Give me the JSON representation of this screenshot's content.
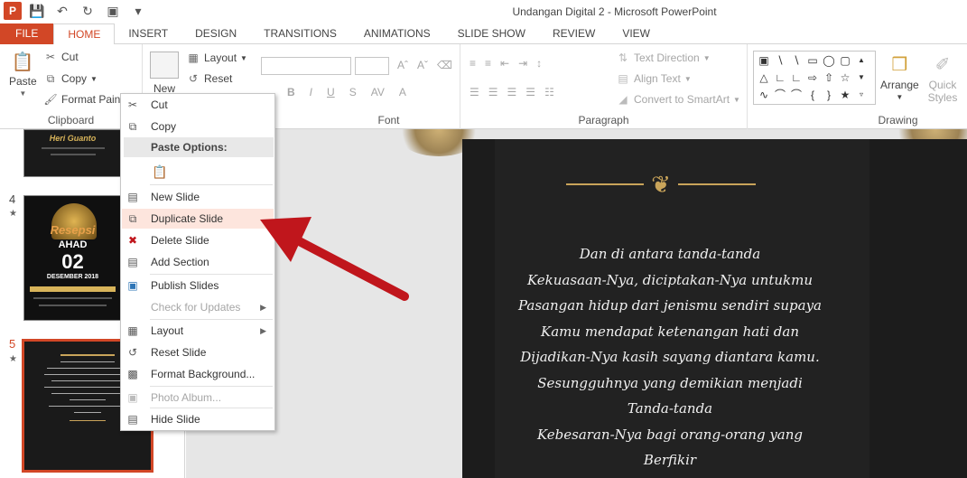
{
  "window": {
    "title": "Undangan Digital 2 - Microsoft PowerPoint"
  },
  "qat": {
    "logo": "P",
    "icons": [
      "save-icon",
      "undo-icon",
      "redo-icon",
      "present-icon",
      "customize-icon"
    ]
  },
  "tabs": [
    "FILE",
    "HOME",
    "INSERT",
    "DESIGN",
    "TRANSITIONS",
    "ANIMATIONS",
    "SLIDE SHOW",
    "REVIEW",
    "VIEW"
  ],
  "ribbon": {
    "paste": "Paste",
    "cut": "Cut",
    "copy": "Copy",
    "format_painter": "Format Painter",
    "new_slide": "New",
    "layout": "Layout",
    "reset": "Reset",
    "text_direction": "Text Direction",
    "align_text": "Align Text",
    "convert_smartart": "Convert to SmartArt",
    "arrange": "Arrange",
    "quick_styles": "Quick Styles",
    "groups": {
      "clipboard": "Clipboard",
      "font": "Font",
      "paragraph": "Paragraph",
      "drawing": "Drawing"
    },
    "font_buttons": [
      "B",
      "I",
      "U",
      "S"
    ]
  },
  "thumbnails": [
    {
      "number": "",
      "text": "Heri Guanto"
    },
    {
      "number": "4",
      "star": "★",
      "title": "Resepsi",
      "day": "AHAD",
      "date": "02",
      "month": "DESEMBER 2018"
    },
    {
      "number": "5",
      "star": "★"
    }
  ],
  "context_menu": {
    "cut": "Cut",
    "copy": "Copy",
    "paste_options": "Paste Options:",
    "new_slide": "New Slide",
    "duplicate_slide": "Duplicate Slide",
    "delete_slide": "Delete Slide",
    "add_section": "Add Section",
    "publish_slides": "Publish Slides",
    "check_updates": "Check for Updates",
    "layout": "Layout",
    "reset_slide": "Reset Slide",
    "format_background": "Format Background...",
    "photo_album": "Photo Album...",
    "hide_slide": "Hide Slide"
  },
  "slide": {
    "lines": [
      "Dan di antara tanda-tanda",
      "Kekuasaan-Nya, diciptakan-Nya untukmu",
      "Pasangan hidup dari jenismu sendiri supaya",
      "Kamu mendapat ketenangan hati dan",
      "Dijadikan-Nya kasih sayang diantara kamu.",
      "Sesungguhnya yang demikian menjadi",
      "Tanda-tanda",
      "Kebesaran-Nya bagi orang-orang yang",
      "Berfikir"
    ]
  },
  "colors": {
    "accent": "#d24726",
    "highlight": "#fde5dd",
    "arrow": "#c0161c",
    "gold": "#c9a45a"
  }
}
